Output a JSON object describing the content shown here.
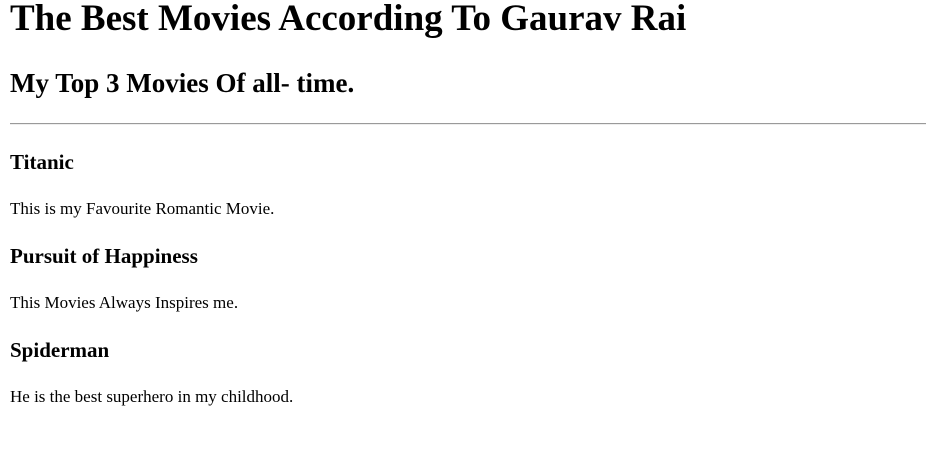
{
  "header": {
    "title": "The Best Movies According To Gaurav Rai",
    "subtitle": "My Top 3 Movies Of all- time."
  },
  "movies": [
    {
      "title": "Titanic",
      "description": "This is my Favourite Romantic Movie."
    },
    {
      "title": "Pursuit of Happiness",
      "description": "This Movies Always Inspires me."
    },
    {
      "title": "Spiderman",
      "description": "He is the best superhero in my childhood."
    }
  ]
}
